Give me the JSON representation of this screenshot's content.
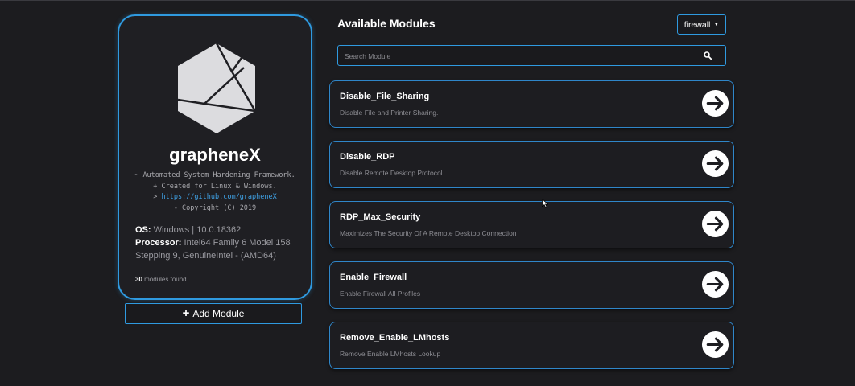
{
  "profile": {
    "app_name": "grapheneX",
    "tagline_1": "~ Automated System Hardening Framework.",
    "tagline_2": "+ Created for Linux & Windows.",
    "tagline_3_prefix": ">",
    "tagline_3_link": "https://github.com/grapheneX",
    "tagline_4": "- Copyright (C) 2019",
    "os_label": "OS:",
    "os_value": "Windows | 10.0.18362",
    "processor_label": "Processor:",
    "processor_value": "Intel64 Family 6 Model 158 Stepping 9, GenuineIntel - (AMD64)",
    "modules_count": "30",
    "modules_suffix": "modules found."
  },
  "add_module": {
    "label": "Add Module"
  },
  "header": {
    "title": "Available Modules",
    "filter_label": "firewall"
  },
  "search": {
    "placeholder": "Search Module",
    "value": ""
  },
  "modules": [
    {
      "name": "Disable_File_Sharing",
      "description": "Disable File and Printer Sharing."
    },
    {
      "name": "Disable_RDP",
      "description": "Disable Remote Desktop Protocol"
    },
    {
      "name": "RDP_Max_Security",
      "description": "Maximizes The Security Of A Remote Desktop Connection"
    },
    {
      "name": "Enable_Firewall",
      "description": "Enable Firewall All Profiles"
    },
    {
      "name": "Remove_Enable_LMhosts",
      "description": "Remove Enable LMhosts Lookup"
    }
  ],
  "icons": {
    "logo": "graphene-hexagon-logo",
    "add": "plus-icon",
    "filter": "caret-down-icon",
    "search": "search-icon",
    "run": "arrow-right-circle-icon"
  },
  "colors": {
    "background": "#1c1c1f",
    "accent": "#2f9ae0",
    "link": "#3fa2e6",
    "muted_text": "#8d8d93"
  }
}
